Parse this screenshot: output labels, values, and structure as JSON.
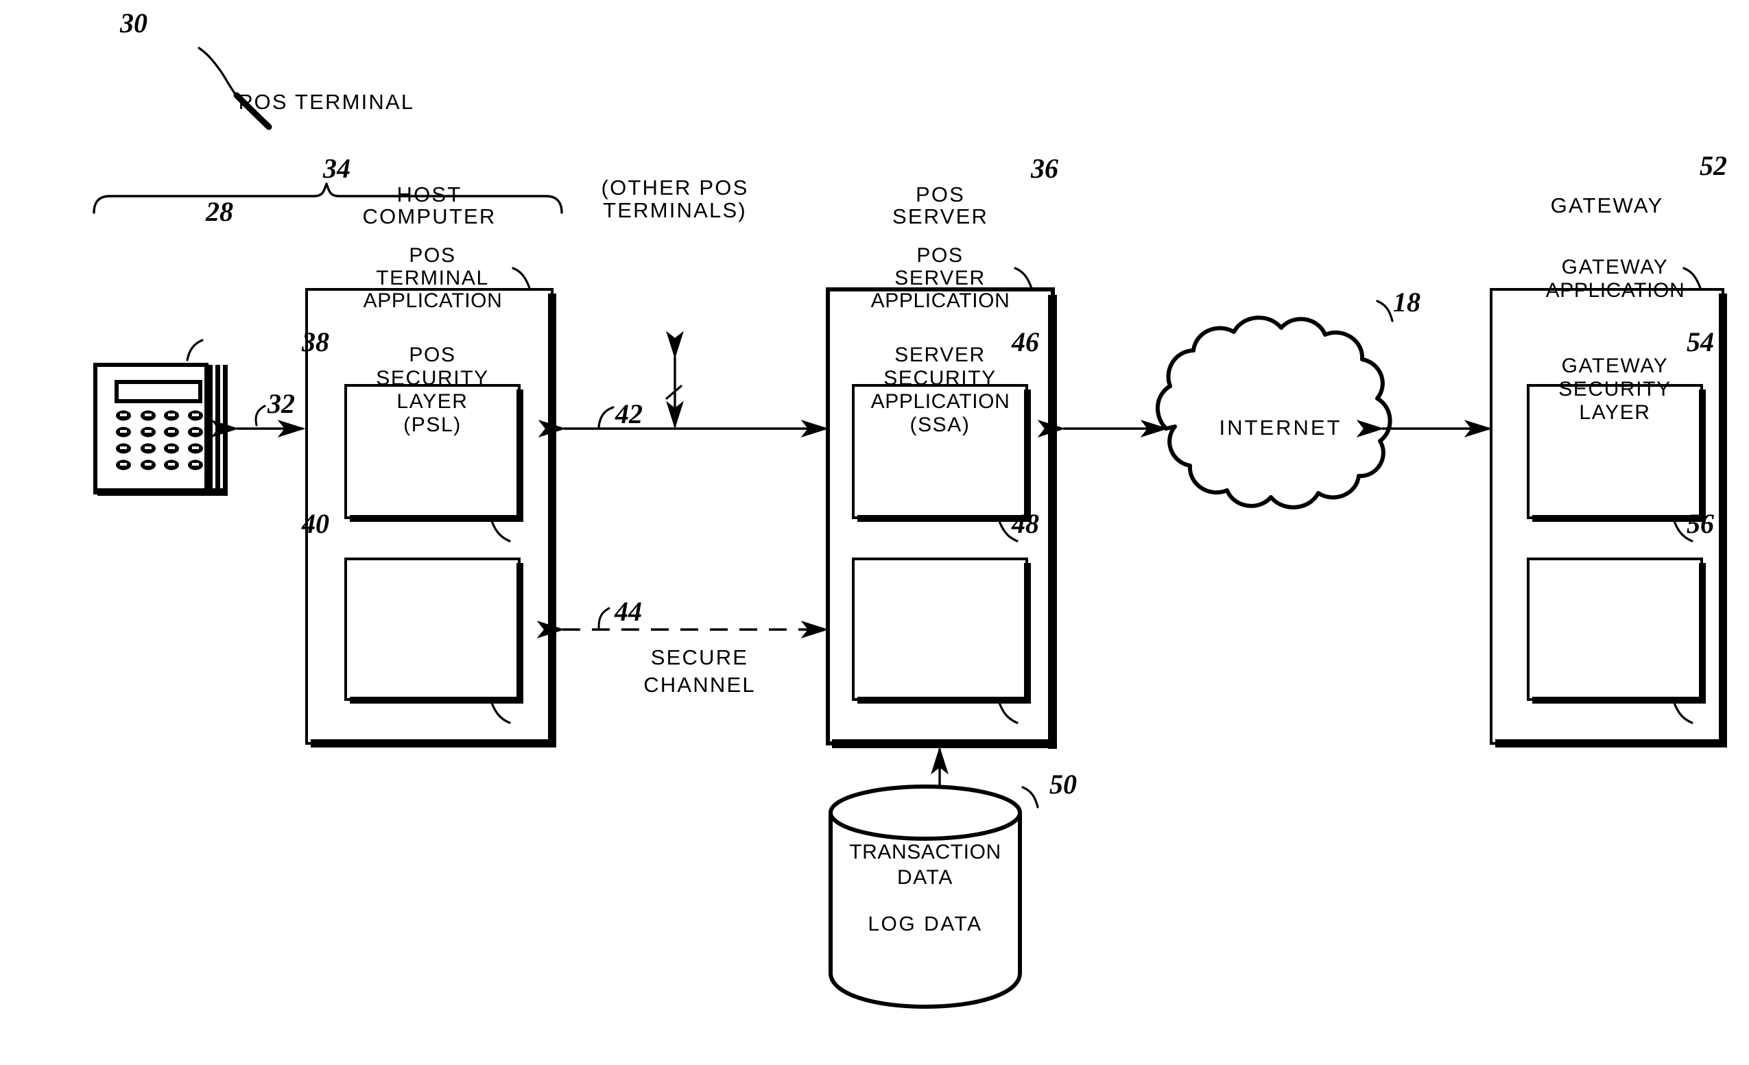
{
  "figure": {
    "figure_ref": "30",
    "group_label": "POS TERMINAL",
    "nodes": {
      "terminal_device": {
        "ref": "28"
      },
      "host_computer": {
        "title_line1": "HOST",
        "title_line2": "COMPUTER",
        "ref": "34",
        "children": [
          {
            "lines": [
              "POS",
              "TERMINAL",
              "APPLICATION"
            ],
            "ref": "38"
          },
          {
            "lines": [
              "POS",
              "SECURITY",
              "LAYER",
              "(PSL)"
            ],
            "ref": "40"
          }
        ]
      },
      "pos_server": {
        "title_line1": "POS",
        "title_line2": "SERVER",
        "ref": "36",
        "children": [
          {
            "lines": [
              "POS",
              "SERVER",
              "APPLICATION"
            ],
            "ref": "46"
          },
          {
            "lines": [
              "SERVER",
              "SECURITY",
              "APPLICATION",
              "(SSA)"
            ],
            "ref": "48"
          }
        ]
      },
      "internet_cloud": {
        "label": "INTERNET",
        "ref": "18"
      },
      "gateway": {
        "title": "GATEWAY",
        "ref": "52",
        "children": [
          {
            "lines": [
              "GATEWAY",
              "APPLICATION"
            ],
            "ref": "54"
          },
          {
            "lines": [
              "GATEWAY",
              "SECURITY",
              "LAYER"
            ],
            "ref": "56"
          }
        ]
      },
      "database": {
        "lines": [
          "TRANSACTION",
          "DATA",
          "LOG DATA"
        ],
        "ref": "50"
      }
    },
    "connections": {
      "terminal_to_host": {
        "ref": "32"
      },
      "host_to_server": {
        "ref": "42",
        "branch_label_line1": "(OTHER POS",
        "branch_label_line2": "TERMINALS)"
      },
      "secure_channel": {
        "ref": "44",
        "label_line1": "SECURE",
        "label_line2": "CHANNEL"
      }
    },
    "colors": {
      "ink": "#000000",
      "paper": "#ffffff"
    }
  }
}
